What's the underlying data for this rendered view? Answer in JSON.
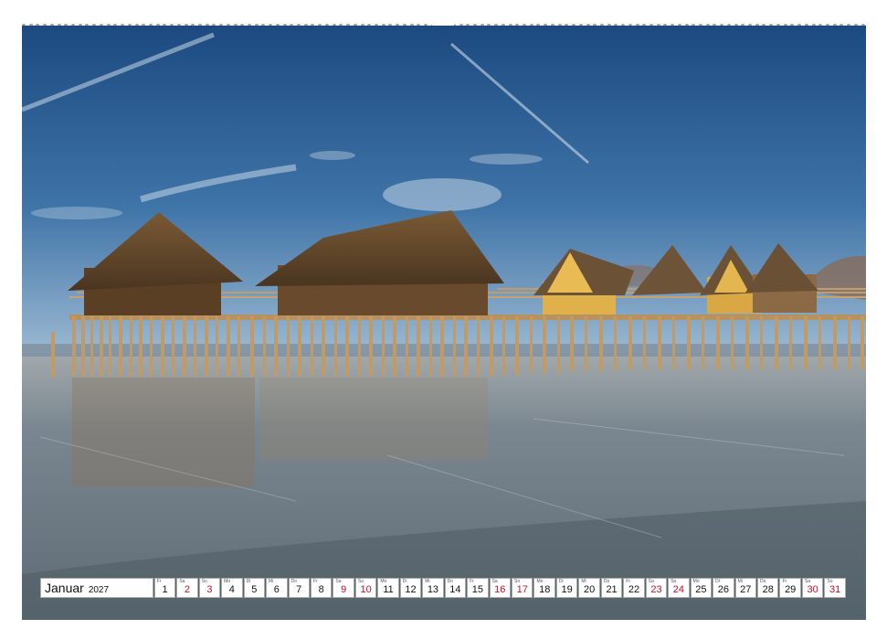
{
  "calendar": {
    "month": "Januar",
    "year": "2027",
    "days": [
      {
        "wd": "Fr",
        "num": "1",
        "weekend": false
      },
      {
        "wd": "Sa",
        "num": "2",
        "weekend": true
      },
      {
        "wd": "So",
        "num": "3",
        "weekend": true
      },
      {
        "wd": "Mo",
        "num": "4",
        "weekend": false
      },
      {
        "wd": "Di",
        "num": "5",
        "weekend": false
      },
      {
        "wd": "Mi",
        "num": "6",
        "weekend": false
      },
      {
        "wd": "Do",
        "num": "7",
        "weekend": false
      },
      {
        "wd": "Fr",
        "num": "8",
        "weekend": false
      },
      {
        "wd": "Sa",
        "num": "9",
        "weekend": true
      },
      {
        "wd": "So",
        "num": "10",
        "weekend": true
      },
      {
        "wd": "Mo",
        "num": "11",
        "weekend": false
      },
      {
        "wd": "Di",
        "num": "12",
        "weekend": false
      },
      {
        "wd": "Mi",
        "num": "13",
        "weekend": false
      },
      {
        "wd": "Do",
        "num": "14",
        "weekend": false
      },
      {
        "wd": "Fr",
        "num": "15",
        "weekend": false
      },
      {
        "wd": "Sa",
        "num": "16",
        "weekend": true
      },
      {
        "wd": "So",
        "num": "17",
        "weekend": true
      },
      {
        "wd": "Mo",
        "num": "18",
        "weekend": false
      },
      {
        "wd": "Di",
        "num": "19",
        "weekend": false
      },
      {
        "wd": "Mi",
        "num": "20",
        "weekend": false
      },
      {
        "wd": "Do",
        "num": "21",
        "weekend": false
      },
      {
        "wd": "Fr",
        "num": "22",
        "weekend": false
      },
      {
        "wd": "Sa",
        "num": "23",
        "weekend": true
      },
      {
        "wd": "So",
        "num": "24",
        "weekend": true
      },
      {
        "wd": "Mo",
        "num": "25",
        "weekend": false
      },
      {
        "wd": "Di",
        "num": "26",
        "weekend": false
      },
      {
        "wd": "Mi",
        "num": "27",
        "weekend": false
      },
      {
        "wd": "Do",
        "num": "28",
        "weekend": false
      },
      {
        "wd": "Fr",
        "num": "29",
        "weekend": false
      },
      {
        "wd": "Sa",
        "num": "30",
        "weekend": true
      },
      {
        "wd": "So",
        "num": "31",
        "weekend": true
      }
    ]
  },
  "colors": {
    "sky_top": "#1f4f86",
    "sky_bottom": "#8fb1cf",
    "ice": "#7f8d96",
    "weekend_red": "#c8102e"
  }
}
